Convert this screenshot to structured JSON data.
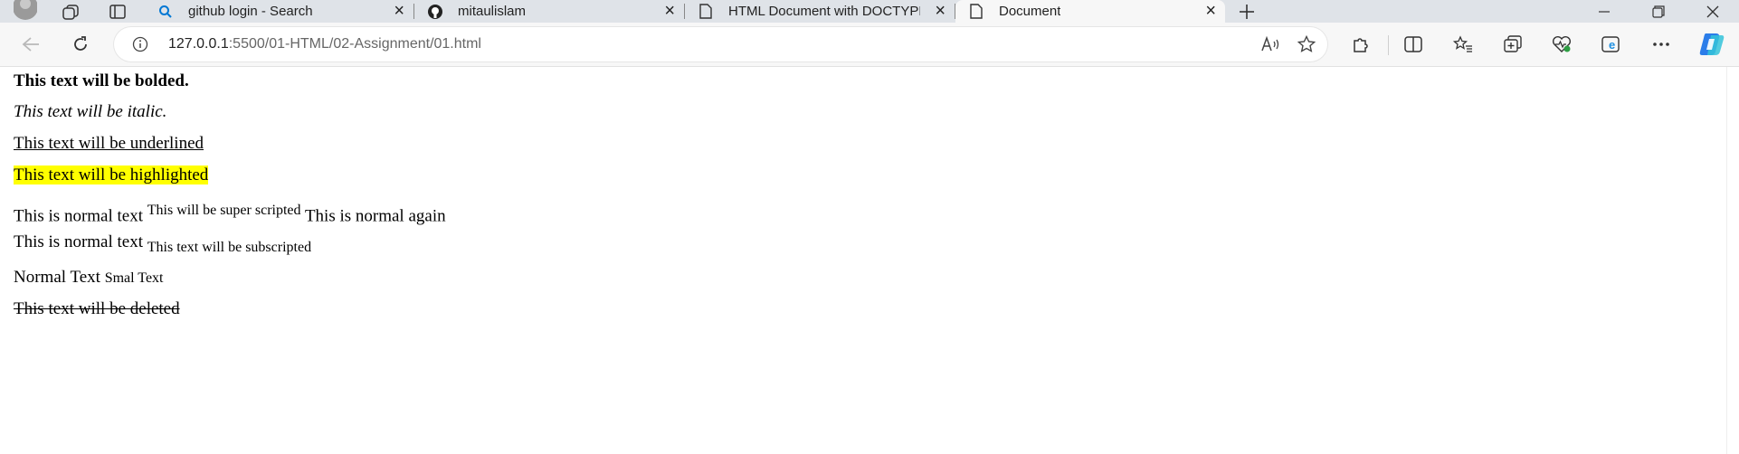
{
  "tabs": [
    {
      "label": "github login - Search",
      "icon": "search-icon"
    },
    {
      "label": "mitaulislam",
      "icon": "github-icon"
    },
    {
      "label": "HTML Document with DOCTYPE",
      "icon": "page-icon"
    },
    {
      "label": "Document",
      "icon": "page-icon"
    }
  ],
  "tab_close": "×",
  "address": {
    "host": "127.0.0.1",
    "rest": ":5500/01-HTML/02-Assignment/01.html"
  },
  "content": {
    "bold": "This text will be bolded.",
    "italic": "This text will be italic.",
    "underline": "This text will be underlined",
    "highlight": "This text will be highlighted",
    "sup_line": {
      "before": "This is normal text",
      "sup": "This will be super scripted",
      "after": "This is normal again"
    },
    "sub_line": {
      "before": "This is normal text",
      "sub": "This text will be subscripted"
    },
    "small_line": {
      "normal": "Normal Text",
      "small": "Smal Text"
    },
    "deleted": "This text will be deleted"
  },
  "colors": {
    "highlight": "#ffff00",
    "accent": "#0078d4"
  }
}
